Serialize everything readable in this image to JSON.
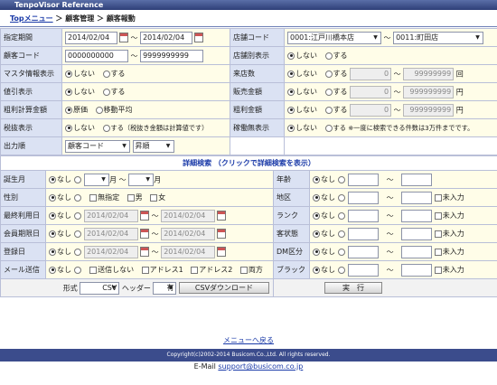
{
  "app_title": "TenpoVisor Reference",
  "breadcrumb": {
    "top": "Topメニュー",
    "sep": "＞",
    "mid": "顧客管理",
    "current": "顧客報動"
  },
  "labels": {
    "period": "指定期間",
    "customer_code": "顧客コード",
    "master": "マスタ情報表示",
    "discount": "値引表示",
    "gross": "粗利計算金額",
    "tax": "税抜表示",
    "order": "出力順",
    "store_code": "店舗コード",
    "store_display": "店舗別表示",
    "visits": "来店数",
    "sales": "販売金額",
    "profit": "粗利金額",
    "inactive": "稼働無表示",
    "birth_month": "誕生月",
    "gender": "性別",
    "last_use": "最終利用日",
    "expiry": "会員期限日",
    "registered": "登録日",
    "mail": "メール送信",
    "age": "年齢",
    "area": "地区",
    "rank": "ランク",
    "customer_status": "客状態",
    "dm": "DM区分",
    "block": "ブラック"
  },
  "values": {
    "period_from": "2014/02/04",
    "period_to": "2014/02/04",
    "tilde": "〜",
    "code_from": "0000000000",
    "code_to": "9999999999",
    "store_from": "0001:江戸川橋本店",
    "store_to": "0011:町田店",
    "num_from": "0",
    "num_to": "99999999",
    "num_max": "999999999",
    "unit_times": "回",
    "unit_yen": "円",
    "order_key": "顧客コード",
    "order_dir": "昇順",
    "month_from": "",
    "month_to": "",
    "month": "月",
    "date_disabled": "2014/02/04"
  },
  "options": {
    "no": "しない",
    "yes": "する",
    "cost": "原価",
    "moving_avg": "移動平均",
    "tax_note": "する（税抜き金額は計算値です）",
    "inactive_note": "する ※一度に検索できる件数は3万件までです。",
    "none": "なし",
    "unspecified": "無指定",
    "male": "男",
    "female": "女",
    "no_send": "送信しない",
    "address1": "アドレス1",
    "address2": "アドレス2",
    "both": "両方",
    "unregistered": "未入力"
  },
  "detail_header": "詳細検索 （クリックで詳細検索を表示）",
  "bottom": {
    "format_label": "形式",
    "format_value": "CSV",
    "header_label": "ヘッダー",
    "header_value": "有",
    "download": "CSVダウンロード",
    "run": "実　行"
  },
  "back_link": "メニューへ戻る",
  "copyright": "Copyright(c)2002-2014 Busicom.Co.,Ltd. All rights reserved.",
  "email_label": "E-Mail",
  "email": "support@busicom.co.jp"
}
